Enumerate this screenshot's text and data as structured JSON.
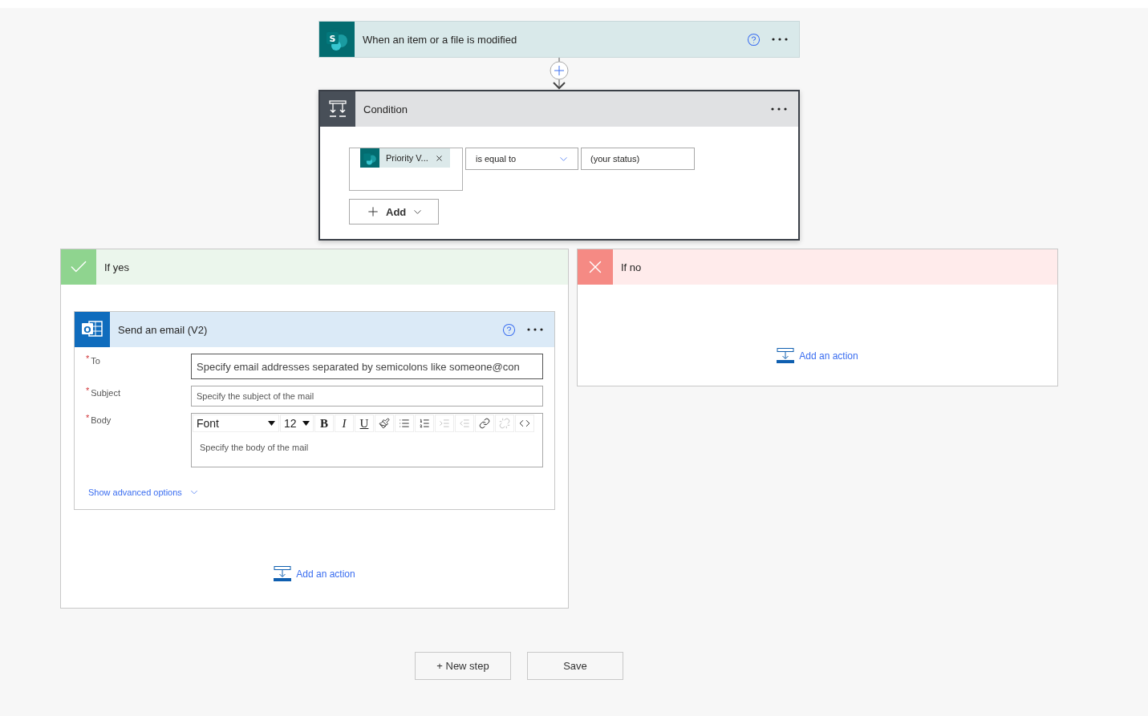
{
  "trigger": {
    "title": "When an item or a file is modified",
    "icon_letter": "S"
  },
  "condition": {
    "title": "Condition",
    "token": "Priority V...",
    "operator": "is equal to",
    "value": "(your status)",
    "add_label": "Add"
  },
  "branches": [
    {
      "kind": "yes",
      "title": "If yes",
      "add_action": "Add an action",
      "actions": [
        {
          "title": "Send an email (V2)",
          "icon_letter": "O",
          "fields": [
            {
              "kind": "input",
              "mark": "*",
              "label": "To",
              "placeholder": "Specify email addresses separated by semicolons like someone@con",
              "focused": true
            },
            {
              "kind": "input",
              "mark": "*",
              "label": "Subject",
              "placeholder": "Specify the subject of the mail",
              "focused": false
            },
            {
              "kind": "editor",
              "mark": "*",
              "label": "Body",
              "placeholder": "Specify the body of the mail",
              "focused": false
            }
          ],
          "toolbar": [
            {
              "kind": "font",
              "label": "Font",
              "disabled": false
            },
            {
              "kind": "size",
              "label": "12",
              "disabled": false
            },
            {
              "kind": "bold",
              "label": "B",
              "disabled": false
            },
            {
              "kind": "italic",
              "label": "I",
              "disabled": false
            },
            {
              "kind": "underline",
              "label": "U",
              "disabled": false
            },
            {
              "kind": "color",
              "disabled": false
            },
            {
              "kind": "bullets",
              "disabled": false
            },
            {
              "kind": "numbering",
              "disabled": false
            },
            {
              "kind": "indent",
              "disabled": true
            },
            {
              "kind": "outdent",
              "disabled": true
            },
            {
              "kind": "link",
              "disabled": false
            },
            {
              "kind": "unlink",
              "disabled": true
            },
            {
              "kind": "code",
              "disabled": false
            }
          ],
          "advanced": "Show advanced options"
        }
      ]
    },
    {
      "kind": "no",
      "title": "If no",
      "add_action": "Add an action"
    }
  ],
  "footer": [
    {
      "label": "+ New step"
    },
    {
      "label": "Save"
    }
  ]
}
